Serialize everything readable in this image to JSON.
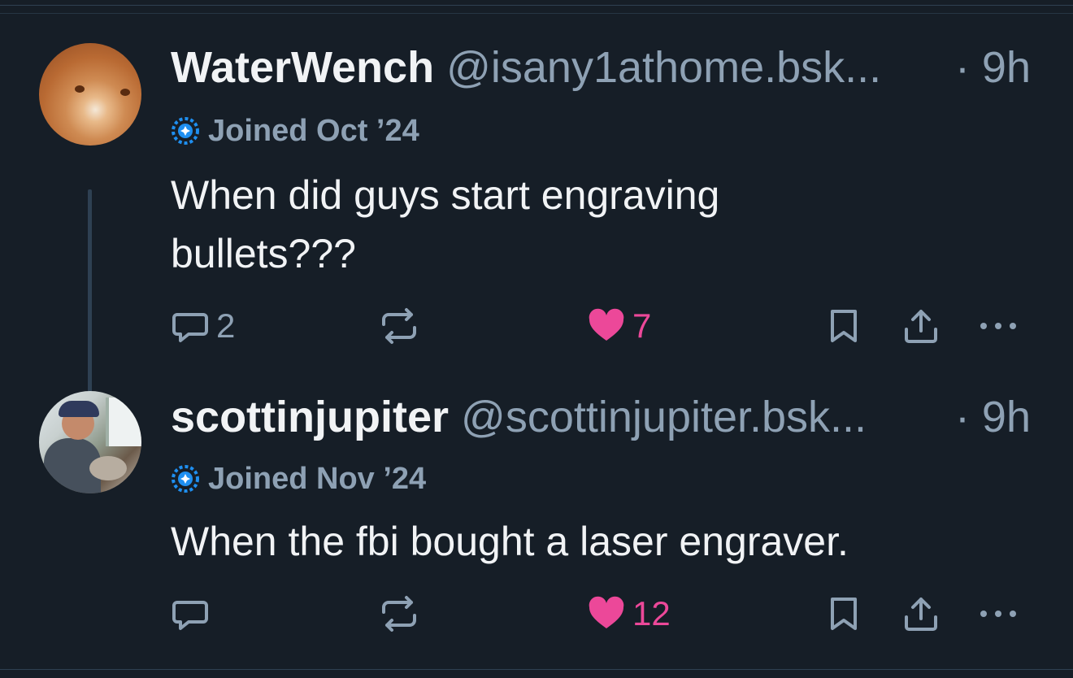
{
  "posts": [
    {
      "display_name": "WaterWench",
      "handle": "@isany1athome.bsk...",
      "time": "· 9h",
      "joined": "Joined Oct ’24",
      "text": "When did guys start engraving bullets???",
      "reply_count": "2",
      "repost_count": "",
      "like_count": "7",
      "liked": true
    },
    {
      "display_name": "scottinjupiter",
      "handle": "@scottinjupiter.bsk...",
      "time": "· 9h",
      "joined": "Joined Nov ’24",
      "text": "When the fbi bought a laser engraver.",
      "reply_count": "",
      "repost_count": "",
      "like_count": "12",
      "liked": true
    }
  ],
  "icons": {
    "reply": "speech-bubble-icon",
    "repost": "repost-arrows-icon",
    "like": "heart-icon",
    "bookmark": "bookmark-icon",
    "share": "share-upload-icon",
    "more": "ellipsis-icon",
    "joined_badge": "new-user-badge-icon"
  },
  "colors": {
    "background": "#161e27",
    "text": "#f1f3f5",
    "muted": "#8ea1b4",
    "like": "#ec4899",
    "badge": "#1f8ff0"
  }
}
